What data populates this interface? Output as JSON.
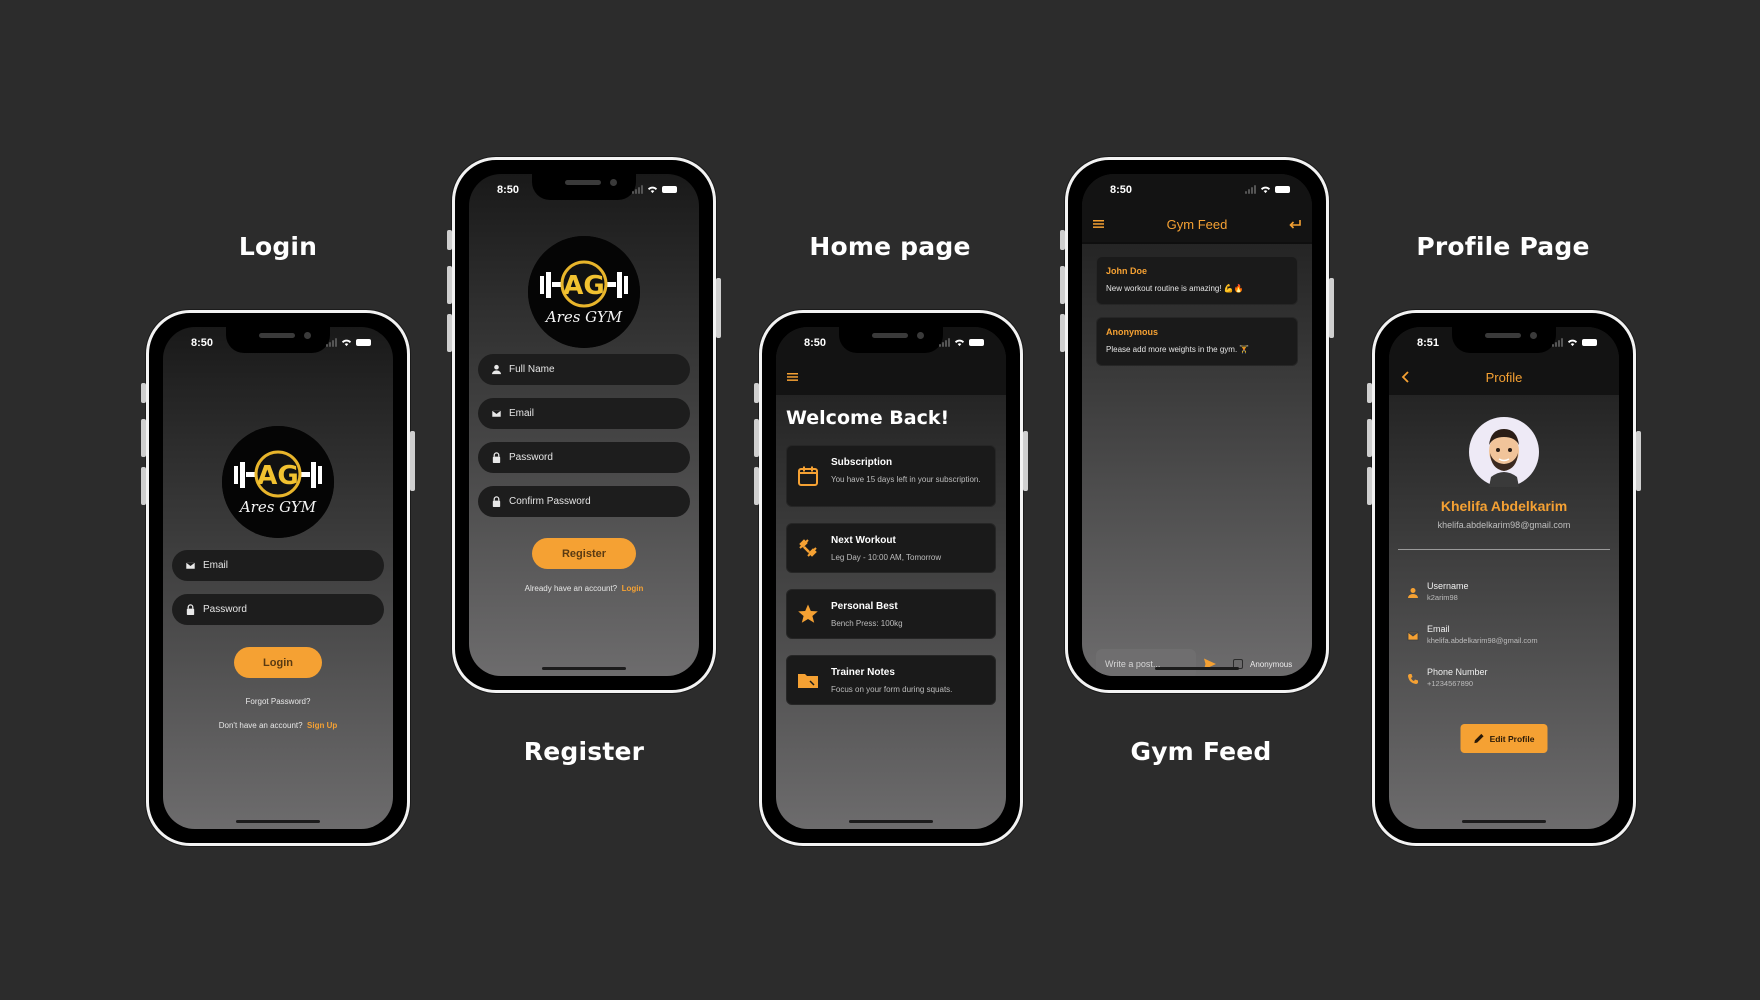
{
  "labels": {
    "login": "Login",
    "register": "Register",
    "home": "Home page",
    "feed": "Gym Feed",
    "profile": "Profile Page"
  },
  "colors": {
    "accent": "#f5a133",
    "background": "#2c2c2c",
    "card": "#1a1a1a"
  },
  "login": {
    "time": "8:50",
    "logo_text": "Ares GYM",
    "email_placeholder": "Email",
    "password_placeholder": "Password",
    "login_button": "Login",
    "forgot": "Forgot Password?",
    "no_account": "Don't have an account?",
    "signup": "Sign Up"
  },
  "register": {
    "time": "8:50",
    "logo_text": "Ares GYM",
    "fullname_placeholder": "Full Name",
    "email_placeholder": "Email",
    "password_placeholder": "Password",
    "confirm_placeholder": "Confirm Password",
    "register_button": "Register",
    "have_account": "Already have an account?",
    "login_link": "Login"
  },
  "home": {
    "time": "8:50",
    "welcome": "Welcome Back!",
    "cards": [
      {
        "title": "Subscription",
        "subtitle": "You have 15 days left in your subscription.",
        "icon": "calendar-icon"
      },
      {
        "title": "Next Workout",
        "subtitle": "Leg Day - 10:00 AM, Tomorrow",
        "icon": "dumbbell-icon"
      },
      {
        "title": "Personal Best",
        "subtitle": "Bench Press: 100kg",
        "icon": "star-icon"
      },
      {
        "title": "Trainer Notes",
        "subtitle": "Focus on your form during squats.",
        "icon": "folder-icon"
      }
    ]
  },
  "feed": {
    "time": "8:50",
    "title": "Gym Feed",
    "posts": [
      {
        "author": "John Doe",
        "text": "New workout routine is amazing! 💪🔥"
      },
      {
        "author": "Anonymous",
        "text": "Please add more weights in the gym. 🏋"
      }
    ],
    "input_placeholder": "Write a post...",
    "anonymous_label": "Anonymous"
  },
  "profile": {
    "time": "8:51",
    "title": "Profile",
    "name": "Khelifa Abdelkarim",
    "email": "khelifa.abdelkarim98@gmail.com",
    "rows": [
      {
        "label": "Username",
        "value": "k2arim98"
      },
      {
        "label": "Email",
        "value": "khelifa.abdelkarim98@gmail.com"
      },
      {
        "label": "Phone Number",
        "value": "+1234567890"
      }
    ],
    "edit_button": "Edit Profile"
  }
}
